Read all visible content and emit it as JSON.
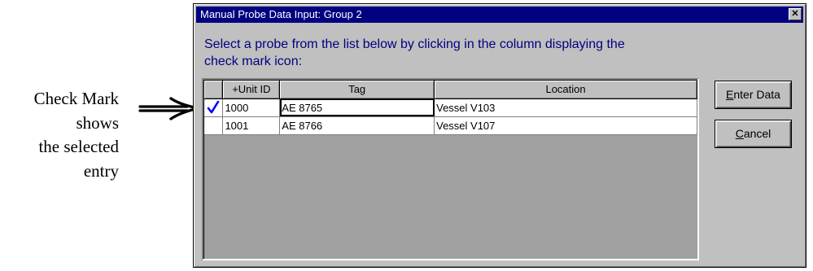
{
  "caption": {
    "lines": [
      "Check Mark",
      "shows",
      "the selected",
      "entry"
    ]
  },
  "dialog": {
    "title": "Manual Probe Data Input: Group 2",
    "close_glyph": "✕",
    "instructions": "Select a probe from the list below by clicking in the column displaying the\ncheck mark icon:",
    "grid": {
      "columns": [
        "",
        "+Unit ID",
        "Tag",
        "Location"
      ],
      "rows": [
        {
          "selected": true,
          "unit_id": "1000",
          "tag": "AE 8765",
          "location": "Vessel V103"
        },
        {
          "selected": false,
          "unit_id": "1001",
          "tag": "AE 8766",
          "location": "Vessel V107"
        }
      ]
    },
    "buttons": {
      "enter_data_first": "E",
      "enter_data_rest": "nter Data",
      "cancel_first": "C",
      "cancel_rest": "ancel"
    }
  },
  "icons": {
    "pointer": "right-arrow-icon",
    "check": "check-mark-icon",
    "close": "close-icon"
  },
  "colors": {
    "title_bar": "#000080",
    "instruction_text": "#000080",
    "check_mark": "#0000ff",
    "face": "#c0c0c0"
  }
}
